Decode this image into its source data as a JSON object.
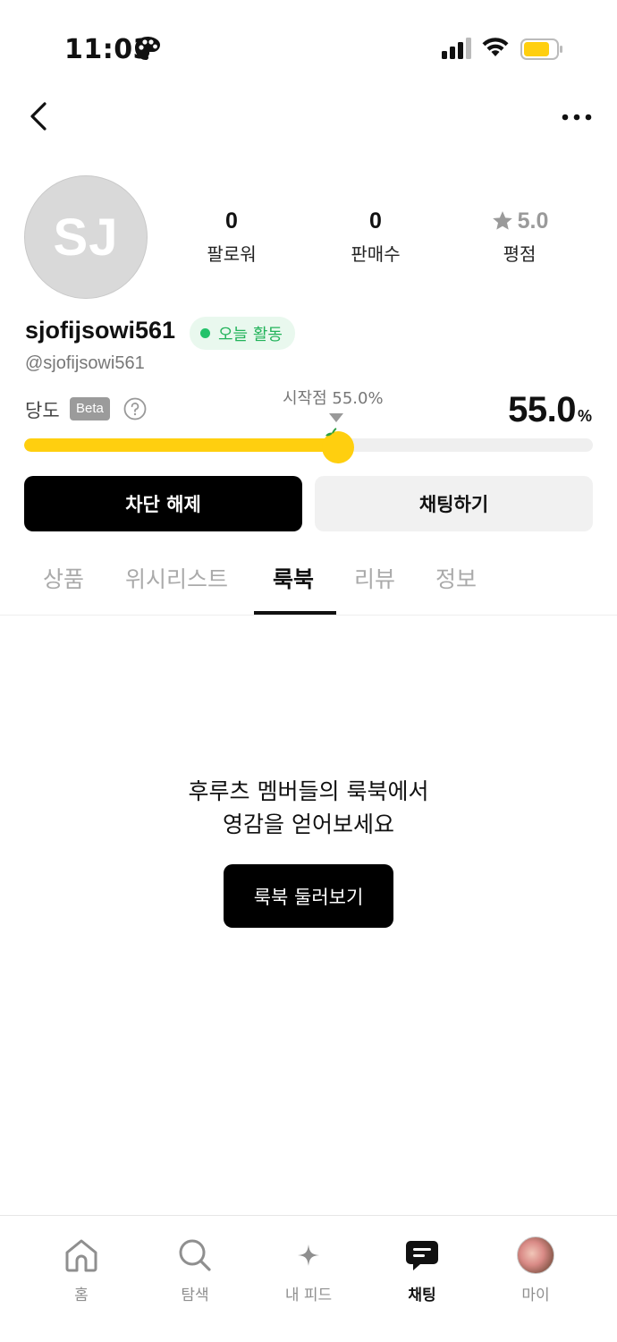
{
  "status_bar": {
    "time": "11:03"
  },
  "profile": {
    "avatar_initials": "SJ",
    "stats": [
      {
        "value": "0",
        "label": "팔로워"
      },
      {
        "value": "0",
        "label": "판매수"
      },
      {
        "value": "5.0",
        "label": "평점"
      }
    ],
    "username": "sjofijsowi561",
    "active_badge": "오늘 활동",
    "handle": "@sjofijsowi561"
  },
  "sweetness": {
    "label": "당도",
    "beta": "Beta",
    "start_point": "시작점 55.0%",
    "value": "55.0",
    "unit": "%",
    "level_percent": 55.0
  },
  "actions": {
    "unblock": "차단 해제",
    "chat": "채팅하기"
  },
  "tabs": [
    {
      "label": "상품",
      "active": false
    },
    {
      "label": "위시리스트",
      "active": false
    },
    {
      "label": "룩북",
      "active": true
    },
    {
      "label": "리뷰",
      "active": false
    },
    {
      "label": "정보",
      "active": false
    }
  ],
  "empty_state": {
    "line1": "후루츠 멤버들의 룩북에서",
    "line2": "영감을 얻어보세요",
    "button": "룩북 둘러보기"
  },
  "bottom_nav": [
    {
      "label": "홈",
      "icon": "home-icon",
      "active": false
    },
    {
      "label": "탐색",
      "icon": "search-icon",
      "active": false
    },
    {
      "label": "내 피드",
      "icon": "sparkle-icon",
      "active": false
    },
    {
      "label": "채팅",
      "icon": "chat-icon",
      "active": true
    },
    {
      "label": "마이",
      "icon": "profile-avatar",
      "active": false
    }
  ],
  "colors": {
    "accent_yellow": "#ffcf0f",
    "active_green": "#23c26a",
    "primary_black": "#000000",
    "track_gray": "#efefef"
  }
}
